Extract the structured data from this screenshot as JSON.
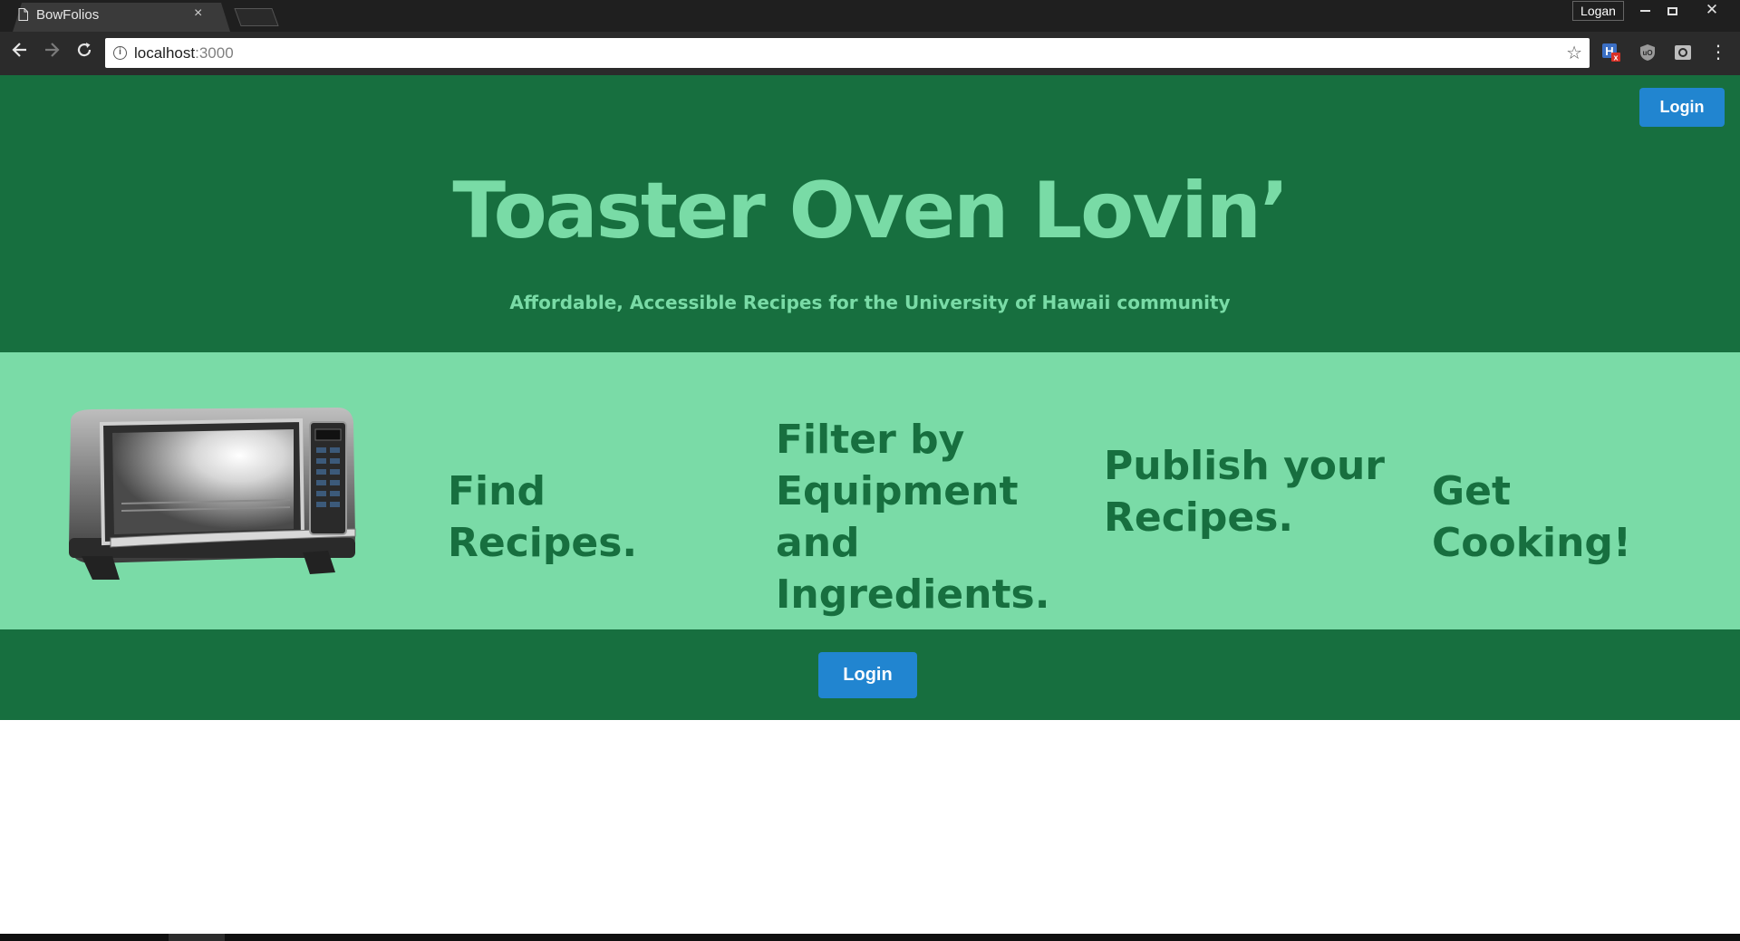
{
  "browser": {
    "tab_title": "BowFolios",
    "tab_close": "×",
    "profile_name": "Logan",
    "url_host": "localhost",
    "url_port": ":3000",
    "window_controls": {
      "close": "✕"
    },
    "icons": [
      "page-icon",
      "back-arrow-icon",
      "forward-arrow-icon",
      "reload-icon",
      "info-icon",
      "star-icon",
      "extension-h-icon",
      "shield-extension-icon",
      "camera-extension-icon",
      "menu-dots-icon"
    ]
  },
  "header": {
    "login_label": "Login"
  },
  "hero": {
    "title": "Toaster Oven Lovin’",
    "subtitle": "Affordable, Accessible Recipes for the University of Hawaii community"
  },
  "features": {
    "items": [
      "Find Recipes.",
      "Filter by Equipment and Ingredients.",
      "Publish your Recipes.",
      "Get Cooking!"
    ]
  },
  "footer": {
    "login_label": "Login"
  },
  "colors": {
    "dark_green": "#176f3f",
    "light_green": "#7adba7",
    "button_blue": "#2185d0"
  }
}
